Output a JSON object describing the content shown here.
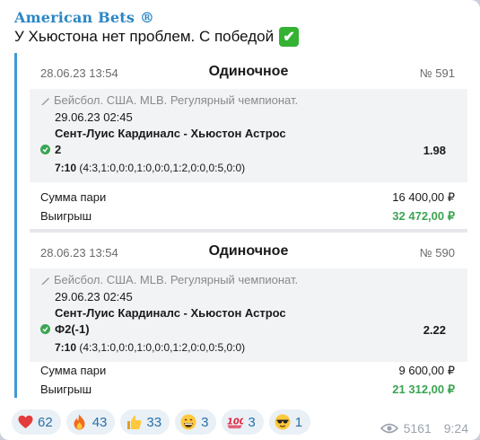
{
  "channel": {
    "name": "American Bets ®"
  },
  "message": {
    "text": "У Хьюстона нет проблем. С победой",
    "emoji": "✔"
  },
  "slips": [
    {
      "date": "28.06.23 13:54",
      "type": "Одиночное",
      "number": "№ 591",
      "league": "Бейсбол. США. MLB. Регулярный чемпионат.",
      "event_date": "29.06.23 02:45",
      "teams": "Сент-Луис Кардиналс - Хьюстон Астрос",
      "pick": "2",
      "odds": "1.98",
      "score_main": "7:10",
      "score_detail": "(4:3,1:0,0:0,1:0,0:0,1:2,0:0,0:5,0:0)",
      "stake_label": "Сумма пари",
      "stake": "16 400,00 ₽",
      "win_label": "Выигрыш",
      "win": "32 472,00 ₽"
    },
    {
      "date": "28.06.23 13:54",
      "type": "Одиночное",
      "number": "№ 590",
      "league": "Бейсбол. США. MLB. Регулярный чемпионат.",
      "event_date": "29.06.23 02:45",
      "teams": "Сент-Луис Кардиналс - Хьюстон Астрос",
      "pick": "Ф2(-1)",
      "odds": "2.22",
      "score_main": "7:10",
      "score_detail": "(4:3,1:0,0:0,1:0,0:0,1:2,0:0,0:5,0:0)",
      "stake_label": "Сумма пари",
      "stake": "9 600,00 ₽",
      "win_label": "Выигрыш",
      "win": "21 312,00 ₽"
    }
  ],
  "reactions": [
    {
      "icon": "heart-icon",
      "count": "62"
    },
    {
      "icon": "fire-icon",
      "count": "43"
    },
    {
      "icon": "thumbs-up-icon",
      "count": "33"
    },
    {
      "icon": "grin-icon",
      "count": "3"
    },
    {
      "icon": "hundred-icon",
      "count": "3"
    },
    {
      "icon": "sunglasses-icon",
      "count": "1"
    }
  ],
  "meta": {
    "views": "5161",
    "time": "9:24"
  },
  "colors": {
    "accent": "#2a86c5",
    "win": "#3aa552",
    "quote_bar": "#3f9bd6"
  }
}
